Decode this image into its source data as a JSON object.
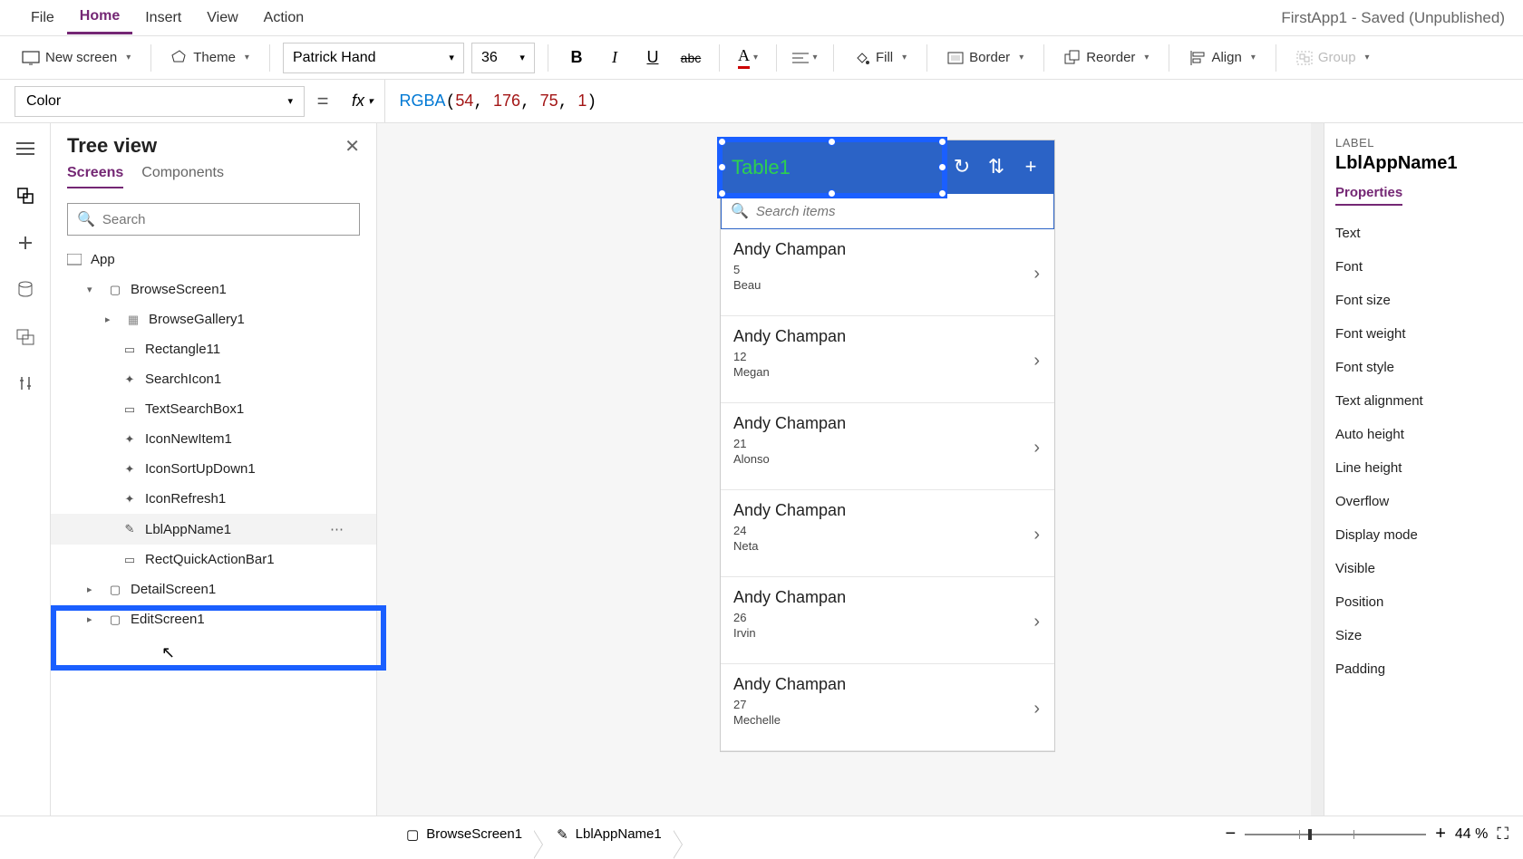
{
  "menubar": {
    "items": [
      "File",
      "Home",
      "Insert",
      "View",
      "Action"
    ],
    "active_index": 1,
    "doc_title": "FirstApp1 - Saved (Unpublished)"
  },
  "ribbon": {
    "new_screen": "New screen",
    "theme": "Theme",
    "font": "Patrick Hand",
    "font_size": "36",
    "fill": "Fill",
    "border": "Border",
    "reorder": "Reorder",
    "align": "Align",
    "group": "Group"
  },
  "formula": {
    "property": "Color",
    "fx": "fx",
    "fn": "RGBA",
    "args": [
      "54",
      "176",
      "75",
      "1"
    ]
  },
  "tree": {
    "title": "Tree view",
    "tabs": [
      "Screens",
      "Components"
    ],
    "active_tab": 0,
    "search_placeholder": "Search",
    "app_node": "App",
    "nodes": [
      {
        "label": "BrowseScreen1",
        "expanded": true
      },
      {
        "label": "BrowseGallery1"
      },
      {
        "label": "Rectangle11"
      },
      {
        "label": "SearchIcon1"
      },
      {
        "label": "TextSearchBox1"
      },
      {
        "label": "IconNewItem1"
      },
      {
        "label": "IconSortUpDown1"
      },
      {
        "label": "IconRefresh1"
      },
      {
        "label": "LblAppName1",
        "selected": true
      },
      {
        "label": "RectQuickActionBar1"
      },
      {
        "label": "DetailScreen1"
      },
      {
        "label": "EditScreen1"
      }
    ]
  },
  "canvas": {
    "selected_label_text": "Table1",
    "search_placeholder": "Search items",
    "items": [
      {
        "title": "Andy Champan",
        "n": "5",
        "name": "Beau"
      },
      {
        "title": "Andy Champan",
        "n": "12",
        "name": "Megan"
      },
      {
        "title": "Andy Champan",
        "n": "21",
        "name": "Alonso"
      },
      {
        "title": "Andy Champan",
        "n": "24",
        "name": "Neta"
      },
      {
        "title": "Andy Champan",
        "n": "26",
        "name": "Irvin"
      },
      {
        "title": "Andy Champan",
        "n": "27",
        "name": "Mechelle"
      }
    ]
  },
  "props_panel": {
    "category": "LABEL",
    "element": "LblAppName1",
    "tab": "Properties",
    "props": [
      "Text",
      "Font",
      "Font size",
      "Font weight",
      "Font style",
      "Text alignment",
      "Auto height",
      "Line height",
      "Overflow",
      "Display mode",
      "Visible",
      "Position",
      "Size",
      "Padding"
    ]
  },
  "breadcrumb": {
    "items": [
      "BrowseScreen1",
      "LblAppName1"
    ]
  },
  "zoom": {
    "value": "44",
    "unit": "%"
  }
}
